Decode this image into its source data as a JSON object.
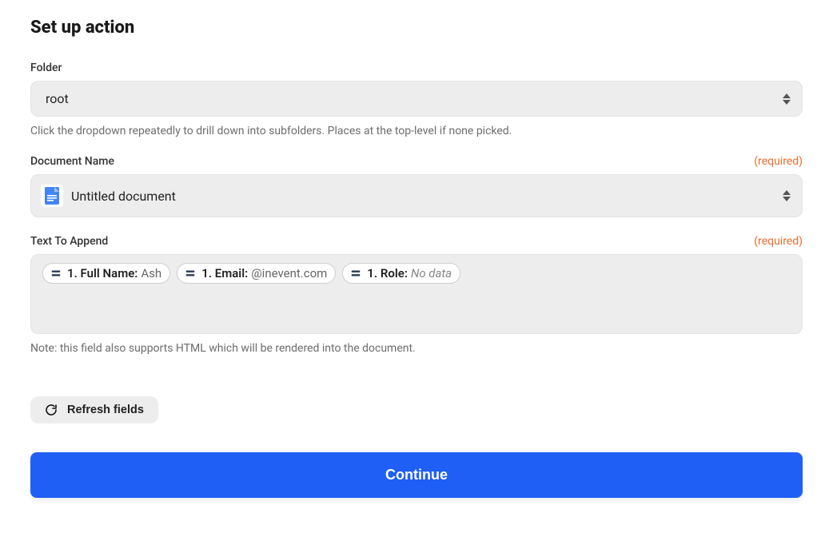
{
  "title": "Set up action",
  "folder": {
    "label": "Folder",
    "value": "root",
    "help": "Click the dropdown repeatedly to drill down into subfolders. Places at the top-level if none picked."
  },
  "document_name": {
    "label": "Document Name",
    "required": "(required)",
    "value": "Untitled document"
  },
  "text_to_append": {
    "label": "Text To Append",
    "required": "(required)",
    "chips": [
      {
        "prefix": "1. Full Name:",
        "value": "Ash",
        "nodata": false
      },
      {
        "prefix": "1. Email:",
        "value": "@inevent.com",
        "nodata": false
      },
      {
        "prefix": "1. Role:",
        "value": "No data",
        "nodata": true
      }
    ],
    "help": "Note: this field also supports HTML which will be rendered into the document."
  },
  "refresh_label": "Refresh fields",
  "continue_label": "Continue"
}
